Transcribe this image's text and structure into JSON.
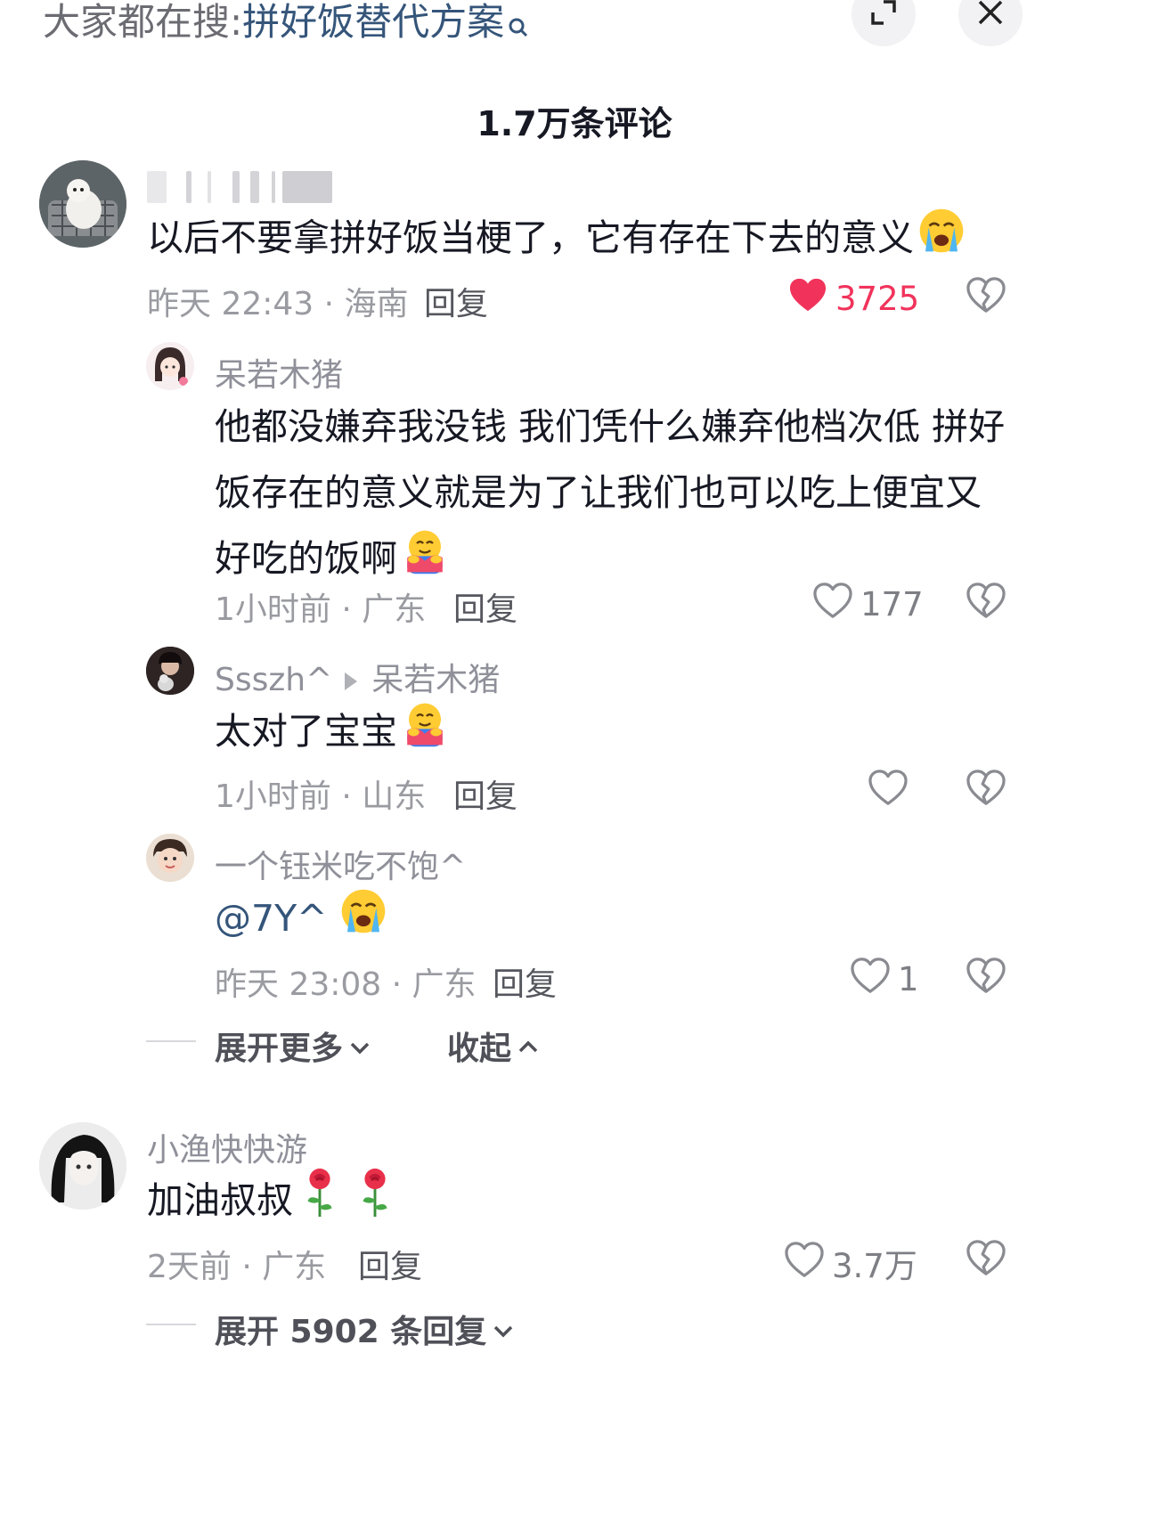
{
  "search": {
    "prefix": "大家都在搜:",
    "term": "拼好饭替代方案"
  },
  "header": {
    "comment_count": "1.7万条评论"
  },
  "comments": [
    {
      "text": "以后不要拿拼好饭当梗了，它有存在下去的意义",
      "emoji": "loudly-crying-face",
      "time_loc": "昨天 22:43 · 海南",
      "reply_label": "回复",
      "likes": "3725",
      "liked": true
    },
    {
      "username": "呆若木猪",
      "text": "他都没嫌弃我没钱 我们凭什么嫌弃他档次低 拼好饭存在的意义就是为了让我们也可以吃上便宜又好吃的饭啊",
      "emoji": "hugging-face",
      "time_loc": "1小时前 · 广东",
      "reply_label": "回复",
      "likes": "177"
    },
    {
      "username": "Ssszh^",
      "reply_to": "呆若木猪",
      "text": "太对了宝宝",
      "emoji": "hugging-face",
      "time_loc": "1小时前 · 山东",
      "reply_label": "回复",
      "likes": ""
    },
    {
      "username": "一个钰米吃不饱^",
      "text": "@7Y^",
      "emoji": "loudly-crying-face",
      "time_loc": "昨天 23:08 · 广东",
      "reply_label": "回复",
      "likes": "1"
    },
    {
      "username": "小渔快快游",
      "text": "加油叔叔",
      "emoji": "rose",
      "time_loc": "2天前 · 广东",
      "reply_label": "回复",
      "likes": "3.7万"
    }
  ],
  "thread_controls": {
    "expand_more": "展开更多",
    "collapse": "收起"
  },
  "expand_replies": "展开 5902 条回复",
  "colors": {
    "like_active": "#f1335b",
    "search_term": "#35557a"
  }
}
